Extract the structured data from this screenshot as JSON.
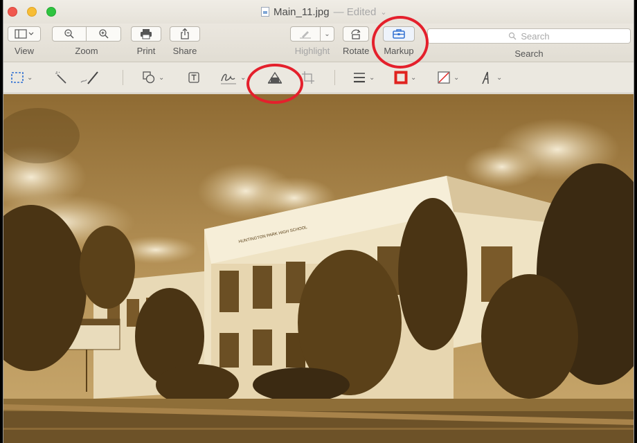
{
  "window": {
    "title": "Main_11.jpg",
    "title_edited": "— Edited",
    "title_chevron": "⌄"
  },
  "toolbar": {
    "view_label": "View",
    "zoom_label": "Zoom",
    "print_label": "Print",
    "share_label": "Share",
    "highlight_label": "Highlight",
    "rotate_label": "Rotate",
    "markup_label": "Markup",
    "search_placeholder": "Search",
    "search_label": "Search"
  },
  "photo": {
    "school_sign": "HUNTINGTON PARK HIGH SCHOOL"
  },
  "colors": {
    "sepia_light": "#e8d9b8",
    "sepia_mid": "#a8834a",
    "sepia_dark": "#3b2a12",
    "annotation": "#e4202c"
  },
  "icons": [
    "sidebar-icon",
    "zoom-out-icon",
    "zoom-in-icon",
    "print-icon",
    "share-icon",
    "highlight-icon",
    "rotate-icon",
    "markup-toolbox-icon",
    "search-icon",
    "rect-selection-icon",
    "instant-alpha-icon",
    "sketch-icon",
    "shapes-icon",
    "text-icon",
    "sign-icon",
    "adjust-color-icon",
    "crop-icon",
    "shape-style-icon",
    "border-color-icon",
    "fill-color-icon",
    "text-style-icon"
  ]
}
